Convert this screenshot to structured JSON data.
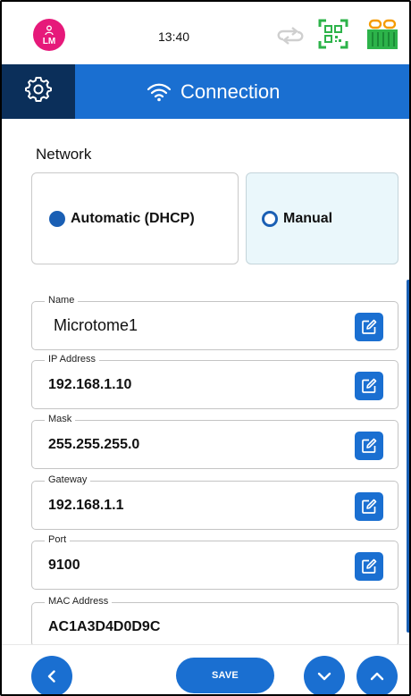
{
  "status_bar": {
    "user_initials": "LM",
    "time": "13:40",
    "icons": [
      "user-icon",
      "sync-icon",
      "qr-code-icon",
      "cassette-icon"
    ]
  },
  "header": {
    "title": "Connection",
    "icons": [
      "gear-icon",
      "wifi-icon"
    ]
  },
  "network": {
    "section_label": "Network",
    "options": [
      {
        "label": "Automatic (DHCP)",
        "selected": true
      },
      {
        "label": "Manual",
        "selected": false
      }
    ]
  },
  "fields": [
    {
      "label": "Name",
      "value": "Microtome1",
      "editable": true
    },
    {
      "label": "IP Address",
      "value": "192.168.1.10",
      "editable": true
    },
    {
      "label": "Mask",
      "value": "255.255.255.0",
      "editable": true
    },
    {
      "label": "Gateway",
      "value": "192.168.1.1",
      "editable": true
    },
    {
      "label": "Port",
      "value": "9100",
      "editable": true
    },
    {
      "label": "MAC Address",
      "value": "AC1A3D4D0D9C",
      "editable": false
    }
  ],
  "bottom_bar": {
    "save_label": "SAVE",
    "icons": [
      "chevron-left-icon",
      "chevron-down-icon",
      "chevron-up-icon"
    ]
  },
  "colors": {
    "primary_blue": "#1a6fd1",
    "dark_navy": "#0b2f5a",
    "avatar_pink": "#e6197a",
    "status_green": "#2db34a",
    "cassette_orange": "#f59b00",
    "manual_card_bg": "#eaf7fb"
  }
}
